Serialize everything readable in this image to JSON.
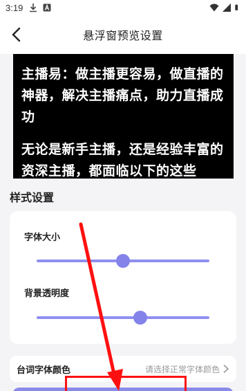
{
  "status_bar": {
    "time": "3:19"
  },
  "header": {
    "title": "悬浮窗预览设置"
  },
  "preview": {
    "paragraphs": [
      "主播易：做主播更容易，做直播的神器，解决主播痛点，助力直播成功",
      "无论是新手主播，还是经验丰富的资深主播，都面临以下的这些"
    ]
  },
  "style_section": {
    "title": "样式设置",
    "font_size": {
      "label": "字体大小",
      "value_fraction": 0.5
    },
    "bg_opacity": {
      "label": "背景透明度",
      "value_fraction": 0.6
    }
  },
  "lyrics_color": {
    "label": "台词字体颜色",
    "placeholder": "请选择正常字体颜色"
  },
  "colors": {
    "accent": "#8383ea",
    "annotation": "#ff1010"
  }
}
